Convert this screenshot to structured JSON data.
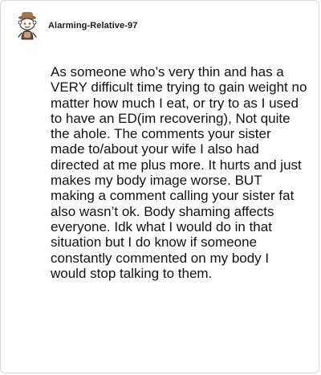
{
  "comment": {
    "author": "Alarming-Relative-97",
    "avatar_icon": "snoo-avatar-icon",
    "body": "As someone who’s very thin and has a VERY difficult time trying to gain weight no matter how much I eat, or try to as I used to have an ED(im recovering), Not quite the ahole. The comments your sister made to/about your wife I also had directed at me plus more. It hurts and just makes my body image worse. BUT making a comment calling your sister fat also wasn’t ok. Body shaming affects everyone. Idk what I would do in that situation but I do know if someone constantly commented on my body I would stop talking to them."
  }
}
